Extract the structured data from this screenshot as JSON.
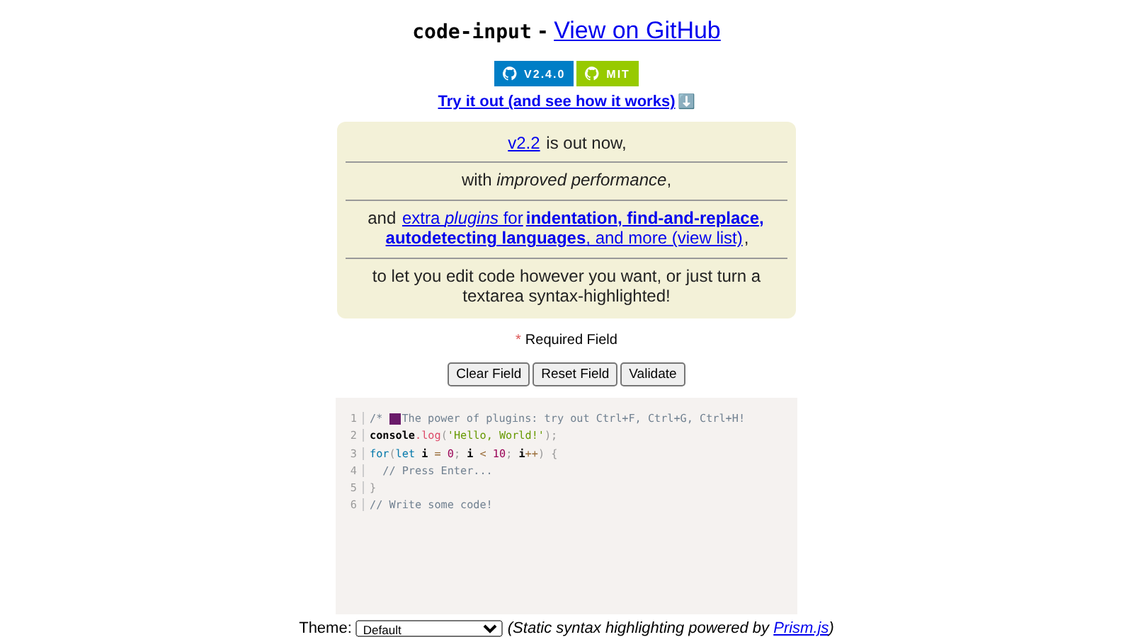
{
  "header": {
    "name": "code-input",
    "separator": "-",
    "link": "View on GitHub"
  },
  "badges": [
    {
      "label": "V2.4.0",
      "color": "#007ec6"
    },
    {
      "label": "MIT",
      "color": "#97ca00"
    }
  ],
  "try_link": "Try it out (and see how it works)",
  "try_icon": "⬇️",
  "notice": [
    [
      {
        "text": "v2.2",
        "kind": "link"
      },
      {
        "text": " is out now,",
        "kind": "text"
      }
    ],
    [
      {
        "text": "with *improved performance*,",
        "kind": "text"
      }
    ],
    [
      {
        "text": "and ",
        "kind": "text"
      },
      {
        "text": "extra *plugins* for",
        "kind": "link"
      },
      {
        "text": "**indentation, find-and-replace,**",
        "kind": "link"
      },
      {
        "text": "**autodetecting languages**, and more (view list)",
        "kind": "link"
      },
      {
        "text": ",",
        "kind": "text"
      }
    ],
    [
      {
        "text": "to let you edit code however you want, or just turn a textarea syntax-highlighted!",
        "kind": "text"
      }
    ]
  ],
  "required": {
    "mark": "*",
    "label": "Required Field"
  },
  "buttons": [
    "Clear Field",
    "Reset Field",
    "Validate"
  ],
  "editor": {
    "lines": [
      {
        "number": "1",
        "tokens": [
          {
            "kind": "comment",
            "text": "/* "
          },
          {
            "kind": "icon"
          },
          {
            "kind": "comment",
            "text": "The power of plugins: try out Ctrl+F, Ctrl+G, Ctrl+H!"
          }
        ]
      },
      {
        "number": "2",
        "tokens": [
          {
            "kind": "bold",
            "text": "console"
          },
          {
            "kind": "func",
            "text": ".log"
          },
          {
            "kind": "punct",
            "text": "("
          },
          {
            "kind": "string",
            "text": "'Hello, World!'"
          },
          {
            "kind": "punct",
            "text": ");"
          }
        ]
      },
      {
        "number": "3",
        "tokens": [
          {
            "kind": "keyword",
            "text": "for"
          },
          {
            "kind": "punct",
            "text": "("
          },
          {
            "kind": "keyword",
            "text": "let"
          },
          {
            "kind": "bold",
            "text": " i "
          },
          {
            "kind": "op",
            "text": "="
          },
          {
            "kind": "number",
            "text": " 0"
          },
          {
            "kind": "punct",
            "text": ";"
          },
          {
            "kind": "bold",
            "text": " i "
          },
          {
            "kind": "op",
            "text": "<"
          },
          {
            "kind": "number",
            "text": " 10"
          },
          {
            "kind": "punct",
            "text": ";"
          },
          {
            "kind": "bold",
            "text": " i"
          },
          {
            "kind": "op",
            "text": "++"
          },
          {
            "kind": "punct",
            "text": ") {"
          }
        ]
      },
      {
        "number": "4",
        "tokens": [
          {
            "kind": "comment",
            "text": "  // Press Enter..."
          }
        ]
      },
      {
        "number": "5",
        "tokens": [
          {
            "kind": "punct",
            "text": "}"
          }
        ]
      },
      {
        "number": "6",
        "tokens": [
          {
            "kind": "comment",
            "text": "// Write some code!"
          }
        ]
      }
    ]
  },
  "theme": {
    "label": "Theme:",
    "value": "Default",
    "note": "(Static syntax highlighting powered by ",
    "note_link": "Prism.js",
    "note_end": ")"
  }
}
